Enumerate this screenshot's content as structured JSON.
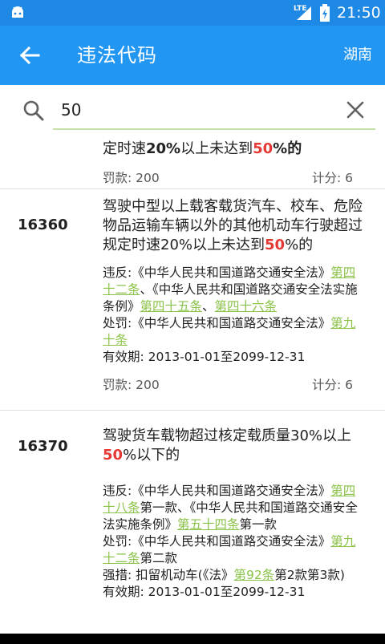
{
  "status_bar": {
    "network": "LTE",
    "time": "21:50"
  },
  "app_bar": {
    "title": "违法代码",
    "region": "湖南"
  },
  "search": {
    "value": "50",
    "placeholder": ""
  },
  "items": [
    {
      "code": "",
      "desc": [
        "定时速",
        "20%",
        "以上未达到",
        "50",
        "%的"
      ],
      "fine_label": "罚款:",
      "fine": "200",
      "points_label": "计分:",
      "points": "6"
    },
    {
      "code": "16360",
      "desc_a": "驾驶中型以上载客载货汽车、校车、危险物品运输车辆以外的其他机动车行驶超过规定时速20%以上未达到",
      "desc_hl": "50",
      "desc_b": "%的",
      "violation_prefix": "违反:《中华人民共和国道路交通安全法》",
      "violation_link1": "第四十二条",
      "violation_mid": "、《中华人民共和国道路交通安全法实施条例》",
      "violation_link2": "第四十五条",
      "violation_sep": "、",
      "violation_link3": "第四十六条",
      "penalty_prefix": "处罚:《中华人民共和国道路交通安全法》",
      "penalty_link": "第九十条",
      "validity": "有效期: 2013-01-01至2099-12-31",
      "fine_label": "罚款:",
      "fine": "200",
      "points_label": "计分:",
      "points": "6"
    },
    {
      "code": "16370",
      "desc_a": "驾驶货车载物超过核定载质量30%以上",
      "desc_hl": "50",
      "desc_b": "%以下的",
      "violation_prefix": "违反:《中华人民共和国道路交通安全法》",
      "violation_link1": "第四十八条",
      "violation_mid": "第一款、《中华人民共和国道路交通安全法实施条例》",
      "violation_link2": "第五十四条",
      "violation_end": "第一款",
      "penalty_prefix": "处罚:《中华人民共和国道路交通安全法》",
      "penalty_link": "第九十二条",
      "penalty_end": "第二款",
      "measure_prefix": "强措: 扣留机动车(《法》",
      "measure_link": "第92条",
      "measure_end": "第2款第3款)",
      "validity": "有效期: 2013-01-01至2099-12-31"
    }
  ]
}
